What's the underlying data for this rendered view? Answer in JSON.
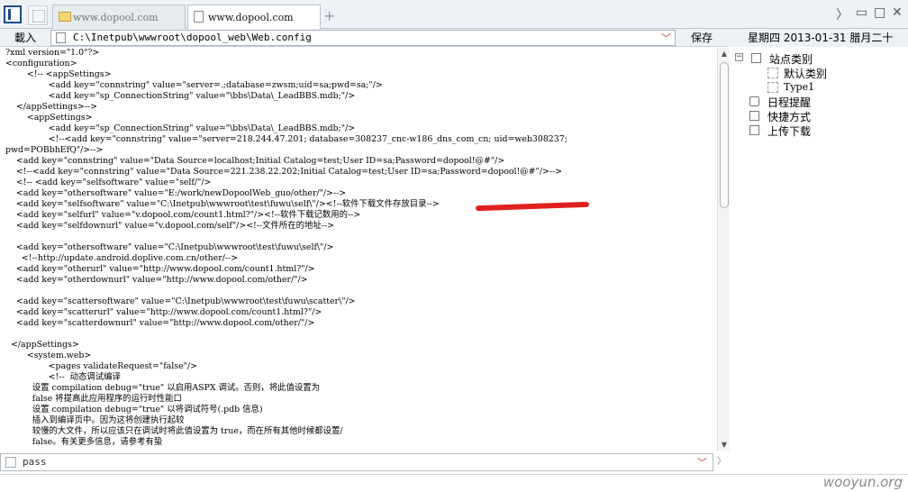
{
  "tabs": [
    {
      "label": "www.dopool.com",
      "active": false,
      "icon": "folder-icon"
    },
    {
      "label": "www.dopool.com",
      "active": true,
      "icon": "page-icon"
    }
  ],
  "new_tab_label": "+",
  "window_controls": {
    "forward": "〉",
    "minimize": "▭",
    "maximize": "□",
    "close": "✕"
  },
  "addressbar": {
    "load_label": "載入",
    "path": "C:\\Inetpub\\wwwroot\\dopool_web\\Web.config",
    "save_label": "保存"
  },
  "date_text": "星期四 2013-01-31 腊月二十",
  "editor_lines": [
    "?xml version=\"1.0\"?>",
    "<configuration>",
    "        <!-- <appSettings>",
    "                <add key=\"connstring\" value=\"server=.;database=zwsm;uid=sa;pwd=sa;\"/>",
    "                <add key=\"sp_ConnectionString\" value=\"\\bbs\\Data\\_LeadBBS.mdb;\"/>",
    "    </appSettings>-->",
    "        <appSettings>",
    "                <add key=\"sp_ConnectionString\" value=\"\\bbs\\Data\\_LeadBBS.mdb;\"/>",
    "                <!--<add key=\"connstring\" value=\"server=218.244.47.201; database=308237_cnc-w186_dns_com_cn; uid=web308237;",
    "pwd=POBbhEfQ\"/>-->",
    "    <add key=\"connstring\" value=\"Data Source=localhost;Initial Catalog=test;User ID=sa;Password=dopool!@#\"/>",
    "    <!--<add key=\"connstring\" value=\"Data Source=221.238.22.202;Initial Catalog=test;User ID=sa;Password=dopool!@#\"/>-->",
    "    <!-- <add key=\"selfsoftware\" value=\"self/\"/>",
    "    <add key=\"othersoftware\" value=\"E:/work/newDopoolWeb_guo/other/\"/>-->",
    "    <add key=\"selfsoftware\" value=\"C:\\Inetpub\\wwwroot\\test\\fuwu\\self\\\"/><!--软件下载文件存放目录-->",
    "    <add key=\"selfurl\" value=\"v.dopool.com/count1.html?\"/><!--软件下载记数用的-->",
    "    <add key=\"selfdownurl\" value=\"v.dopool.com/self\"/><!--文件所在的地址-->",
    "",
    "    <add key=\"othersoftware\" value=\"C:\\Inetpub\\wwwroot\\test\\fuwu\\self\\\"/>",
    "      <!--http://update.android.doplive.com.cn/other/-->",
    "    <add key=\"otherurl\" value=\"http://www.dopool.com/count1.html?\"/>",
    "    <add key=\"otherdownurl\" value=\"http://www.dopool.com/other/\"/>",
    "",
    "    <add key=\"scattersoftware\" value=\"C:\\Inetpub\\wwwroot\\test\\fuwu\\scatter\\\"/>",
    "    <add key=\"scatterurl\" value=\"http://www.dopool.com/count1.html?\"/>",
    "    <add key=\"scatterdownurl\" value=\"http://www.dopool.com/other/\"/>",
    "",
    "  </appSettings>",
    "        <system.web>",
    "                <pages validateRequest=\"false\"/>",
    "                <!--  动态调试编译",
    "          设置 compilation debug=\"true\" 以启用ASPX 调试。否则，将此值设置为",
    "          false 将提高此应用程序的运行时性能口",
    "          设置 compilation debug=\"true\" 以将调试符号(.pdb 信息)",
    "          插入到编译页中。因为这将创建执行起较",
    "          较慢的大文件，所以应该只在调试时将此值设置为 true，而在所有其他时候都设置/",
    "          false。有关更多信息，请参考有蛰"
  ],
  "tree": {
    "root": {
      "label": "站点类别",
      "expander": "−"
    },
    "children": [
      {
        "label": "默认类别"
      },
      {
        "label": "Type1"
      }
    ],
    "items": [
      {
        "label": "日程提醒"
      },
      {
        "label": "快捷方式"
      },
      {
        "label": "上传下载"
      }
    ]
  },
  "bottom_input": {
    "value": "pass"
  },
  "watermark": "wooyun.org",
  "accent_color": "#1c4b8a",
  "redaction_color": "#e02020"
}
